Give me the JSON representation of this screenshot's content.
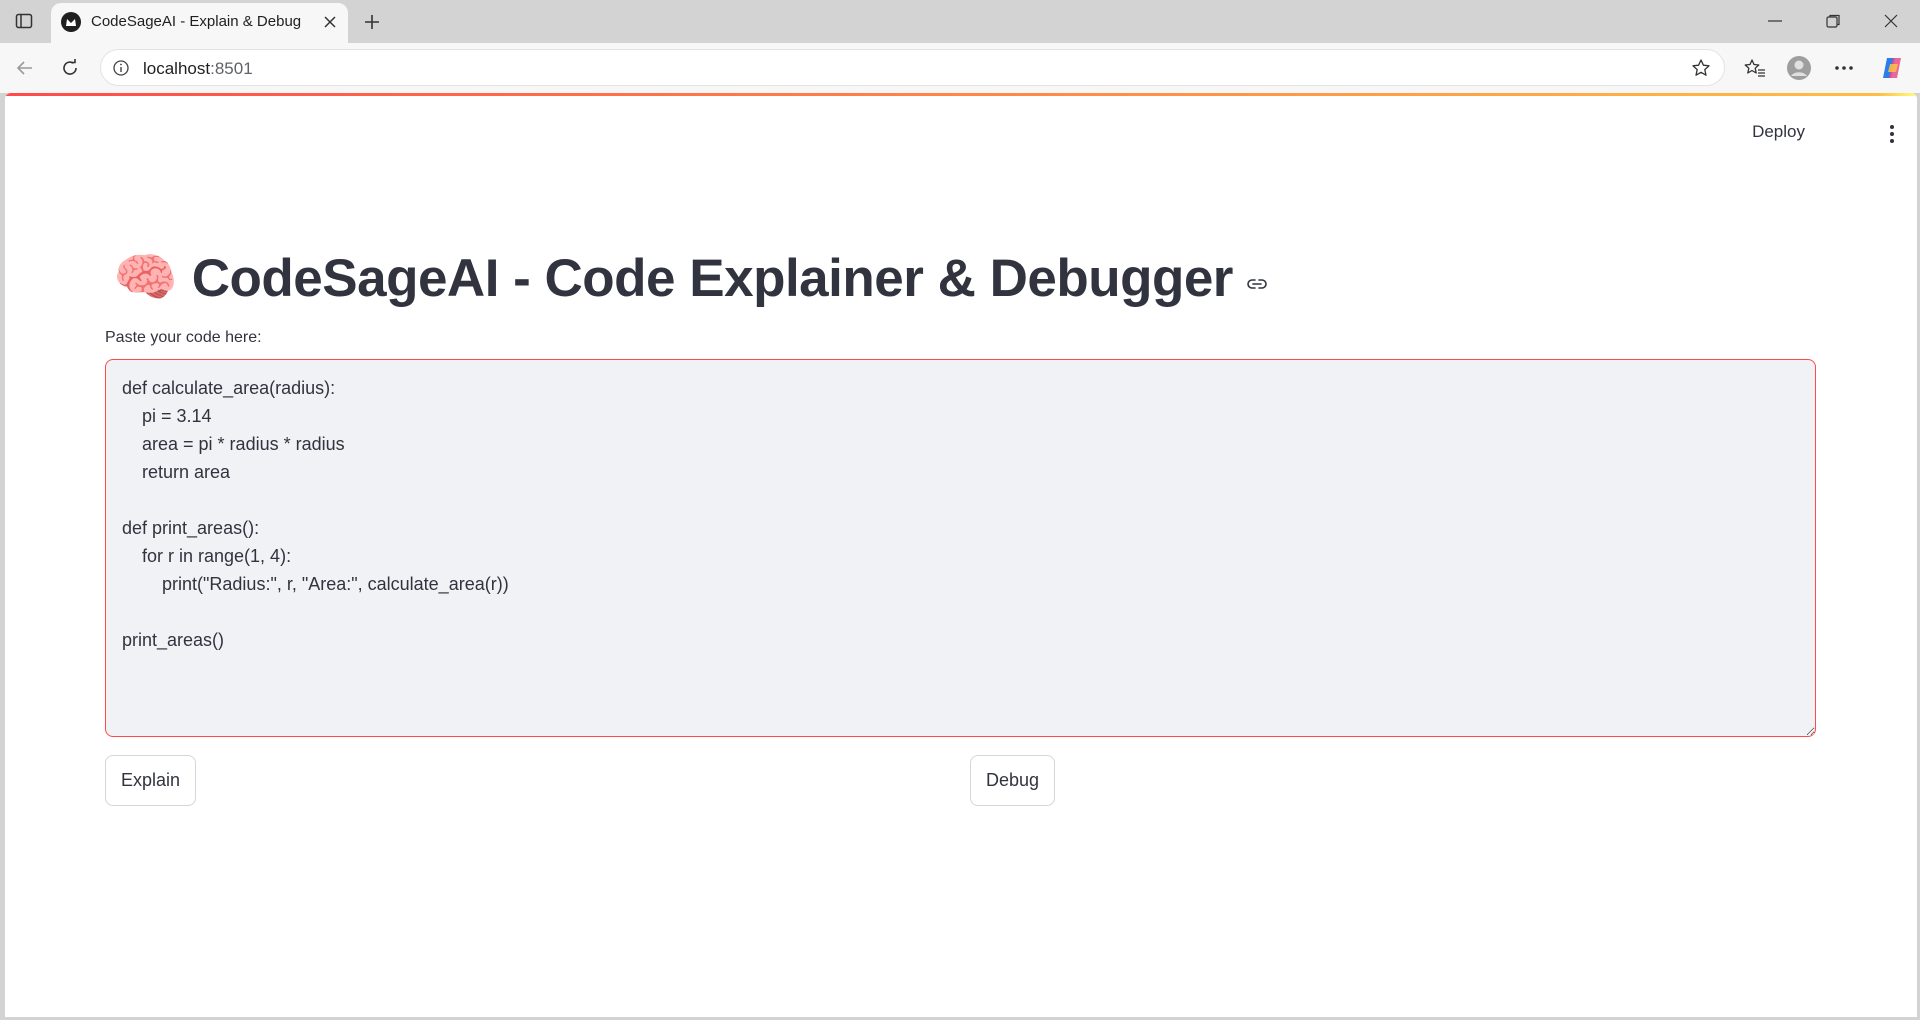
{
  "browser": {
    "tab_title": "CodeSageAI - Explain & Debug",
    "url_host": "localhost",
    "url_port": ":8501"
  },
  "app": {
    "deploy_label": "Deploy",
    "title_emoji": "🧠",
    "title": "CodeSageAI - Code Explainer & Debugger",
    "code_label": "Paste your code here:",
    "code_value": "def calculate_area(radius):\n    pi = 3.14\n    area = pi * radius * radius\n    return area\n\ndef print_areas():\n    for r in range(1, 4):\n        print(\"Radius:\", r, \"Area:\", calculate_area(r))\n\nprint_areas()",
    "explain_label": "Explain",
    "debug_label": "Debug"
  },
  "colors": {
    "accent": "#ff4b4b",
    "text": "#31333f",
    "input_bg": "#f0f2f6"
  },
  "icons": [
    "sidebar-toggle-icon",
    "favicon",
    "close-icon",
    "plus-icon",
    "minimize-icon",
    "restore-icon",
    "window-close-icon",
    "back-icon",
    "reload-icon",
    "info-icon",
    "star-icon",
    "favorites-icon",
    "profile-icon",
    "more-icon",
    "copilot-icon",
    "link-icon",
    "kebab-menu-icon"
  ]
}
